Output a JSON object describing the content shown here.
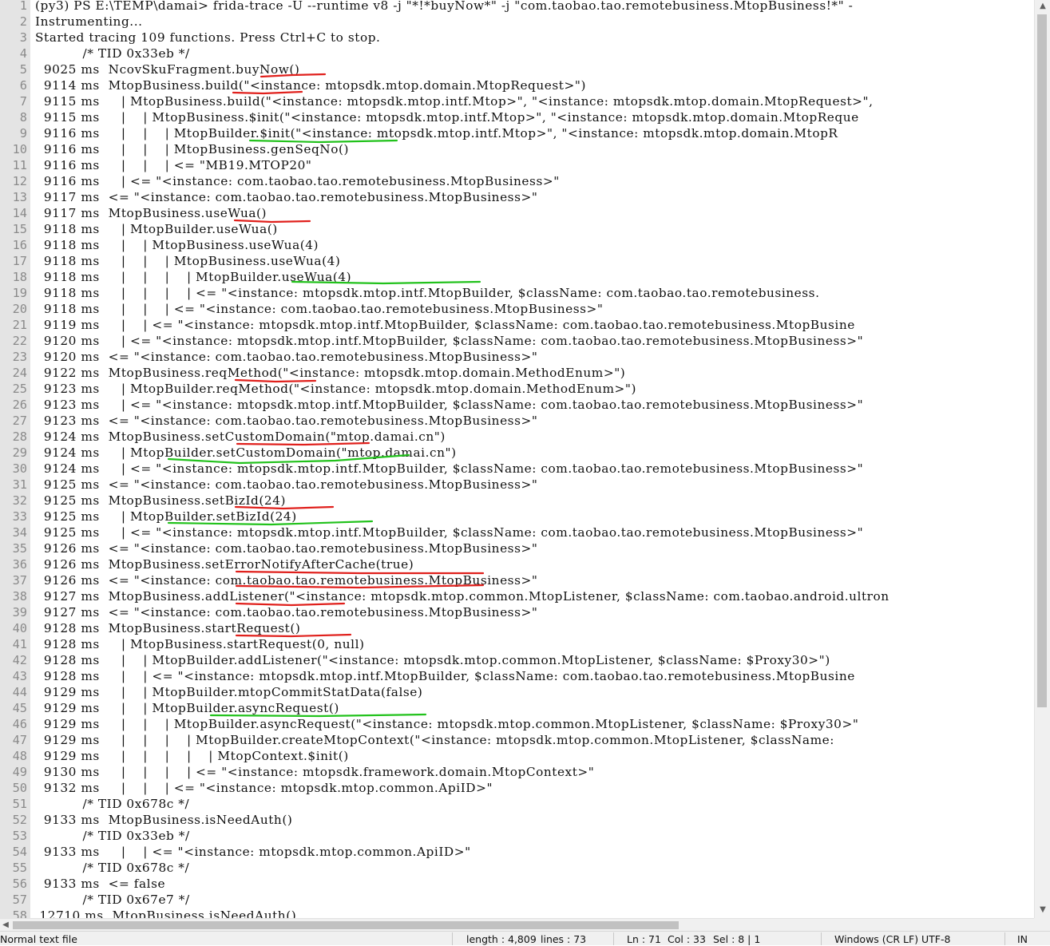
{
  "editor": {
    "lines": [
      {
        "n": "1",
        "t": "(py3) PS E:\\TEMP\\damai> frida-trace -U --runtime v8 -j \"*!*buyNow*\" -j \"com.taobao.tao.remotebusiness.MtopBusiness!*\" -"
      },
      {
        "n": "2",
        "t": "Instrumenting..."
      },
      {
        "n": "3",
        "t": "Started tracing 109 functions. Press Ctrl+C to stop."
      },
      {
        "n": "4",
        "t": "           /* TID 0x33eb */"
      },
      {
        "n": "5",
        "t": "  9025 ms  NcovSkuFragment.buyNow()"
      },
      {
        "n": "6",
        "t": "  9114 ms  MtopBusiness.build(\"<instance: mtopsdk.mtop.domain.MtopRequest>\")"
      },
      {
        "n": "7",
        "t": "  9115 ms     | MtopBusiness.build(\"<instance: mtopsdk.mtop.intf.Mtop>\", \"<instance: mtopsdk.mtop.domain.MtopRequest>\","
      },
      {
        "n": "8",
        "t": "  9115 ms     |    | MtopBusiness.$init(\"<instance: mtopsdk.mtop.intf.Mtop>\", \"<instance: mtopsdk.mtop.domain.MtopReque"
      },
      {
        "n": "9",
        "t": "  9116 ms     |    |    | MtopBuilder.$init(\"<instance: mtopsdk.mtop.intf.Mtop>\", \"<instance: mtopsdk.mtop.domain.MtopR"
      },
      {
        "n": "10",
        "t": "  9116 ms     |    |    | MtopBusiness.genSeqNo()"
      },
      {
        "n": "11",
        "t": "  9116 ms     |    |    | <= \"MB19.MTOP20\""
      },
      {
        "n": "12",
        "t": "  9116 ms     | <= \"<instance: com.taobao.tao.remotebusiness.MtopBusiness>\""
      },
      {
        "n": "13",
        "t": "  9117 ms  <= \"<instance: com.taobao.tao.remotebusiness.MtopBusiness>\""
      },
      {
        "n": "14",
        "t": "  9117 ms  MtopBusiness.useWua()"
      },
      {
        "n": "15",
        "t": "  9118 ms     | MtopBuilder.useWua()"
      },
      {
        "n": "16",
        "t": "  9118 ms     |    | MtopBusiness.useWua(4)"
      },
      {
        "n": "17",
        "t": "  9118 ms     |    |    | MtopBusiness.useWua(4)"
      },
      {
        "n": "18",
        "t": "  9118 ms     |    |    |    | MtopBuilder.useWua(4)"
      },
      {
        "n": "19",
        "t": "  9118 ms     |    |    |    | <= \"<instance: mtopsdk.mtop.intf.MtopBuilder, $className: com.taobao.tao.remotebusiness."
      },
      {
        "n": "20",
        "t": "  9118 ms     |    |    | <= \"<instance: com.taobao.tao.remotebusiness.MtopBusiness>\""
      },
      {
        "n": "21",
        "t": "  9119 ms     |    | <= \"<instance: mtopsdk.mtop.intf.MtopBuilder, $className: com.taobao.tao.remotebusiness.MtopBusine"
      },
      {
        "n": "22",
        "t": "  9120 ms     | <= \"<instance: mtopsdk.mtop.intf.MtopBuilder, $className: com.taobao.tao.remotebusiness.MtopBusiness>\""
      },
      {
        "n": "23",
        "t": "  9120 ms  <= \"<instance: com.taobao.tao.remotebusiness.MtopBusiness>\""
      },
      {
        "n": "24",
        "t": "  9122 ms  MtopBusiness.reqMethod(\"<instance: mtopsdk.mtop.domain.MethodEnum>\")"
      },
      {
        "n": "25",
        "t": "  9123 ms     | MtopBuilder.reqMethod(\"<instance: mtopsdk.mtop.domain.MethodEnum>\")"
      },
      {
        "n": "26",
        "t": "  9123 ms     | <= \"<instance: mtopsdk.mtop.intf.MtopBuilder, $className: com.taobao.tao.remotebusiness.MtopBusiness>\""
      },
      {
        "n": "27",
        "t": "  9123 ms  <= \"<instance: com.taobao.tao.remotebusiness.MtopBusiness>\""
      },
      {
        "n": "28",
        "t": "  9124 ms  MtopBusiness.setCustomDomain(\"mtop.damai.cn\")"
      },
      {
        "n": "29",
        "t": "  9124 ms     | MtopBuilder.setCustomDomain(\"mtop.damai.cn\")"
      },
      {
        "n": "30",
        "t": "  9124 ms     | <= \"<instance: mtopsdk.mtop.intf.MtopBuilder, $className: com.taobao.tao.remotebusiness.MtopBusiness>\""
      },
      {
        "n": "31",
        "t": "  9125 ms  <= \"<instance: com.taobao.tao.remotebusiness.MtopBusiness>\""
      },
      {
        "n": "32",
        "t": "  9125 ms  MtopBusiness.setBizId(24)"
      },
      {
        "n": "33",
        "t": "  9125 ms     | MtopBuilder.setBizId(24)"
      },
      {
        "n": "34",
        "t": "  9125 ms     | <= \"<instance: mtopsdk.mtop.intf.MtopBuilder, $className: com.taobao.tao.remotebusiness.MtopBusiness>\""
      },
      {
        "n": "35",
        "t": "  9126 ms  <= \"<instance: com.taobao.tao.remotebusiness.MtopBusiness>\""
      },
      {
        "n": "36",
        "t": "  9126 ms  MtopBusiness.setErrorNotifyAfterCache(true)"
      },
      {
        "n": "37",
        "t": "  9126 ms  <= \"<instance: com.taobao.tao.remotebusiness.MtopBusiness>\""
      },
      {
        "n": "38",
        "t": "  9127 ms  MtopBusiness.addListener(\"<instance: mtopsdk.mtop.common.MtopListener, $className: com.taobao.android.ultron"
      },
      {
        "n": "39",
        "t": "  9127 ms  <= \"<instance: com.taobao.tao.remotebusiness.MtopBusiness>\""
      },
      {
        "n": "40",
        "t": "  9128 ms  MtopBusiness.startRequest()"
      },
      {
        "n": "41",
        "t": "  9128 ms     | MtopBusiness.startRequest(0, null)"
      },
      {
        "n": "42",
        "t": "  9128 ms     |    | MtopBuilder.addListener(\"<instance: mtopsdk.mtop.common.MtopListener, $className: $Proxy30>\")"
      },
      {
        "n": "43",
        "t": "  9128 ms     |    | <= \"<instance: mtopsdk.mtop.intf.MtopBuilder, $className: com.taobao.tao.remotebusiness.MtopBusine"
      },
      {
        "n": "44",
        "t": "  9129 ms     |    | MtopBuilder.mtopCommitStatData(false)"
      },
      {
        "n": "45",
        "t": "  9129 ms     |    | MtopBuilder.asyncRequest()"
      },
      {
        "n": "46",
        "t": "  9129 ms     |    |    | MtopBuilder.asyncRequest(\"<instance: mtopsdk.mtop.common.MtopListener, $className: $Proxy30>\""
      },
      {
        "n": "47",
        "t": "  9129 ms     |    |    |    | MtopBuilder.createMtopContext(\"<instance: mtopsdk.mtop.common.MtopListener, $className:"
      },
      {
        "n": "48",
        "t": "  9129 ms     |    |    |    |    | MtopContext.$init()"
      },
      {
        "n": "49",
        "t": "  9130 ms     |    |    |    | <= \"<instance: mtopsdk.framework.domain.MtopContext>\""
      },
      {
        "n": "50",
        "t": "  9132 ms     |    |    | <= \"<instance: mtopsdk.mtop.common.ApiID>\""
      },
      {
        "n": "51",
        "t": "           /* TID 0x678c */"
      },
      {
        "n": "52",
        "t": "  9133 ms  MtopBusiness.isNeedAuth()"
      },
      {
        "n": "53",
        "t": "           /* TID 0x33eb */"
      },
      {
        "n": "54",
        "t": "  9133 ms     |    | <= \"<instance: mtopsdk.mtop.common.ApiID>\""
      },
      {
        "n": "55",
        "t": "           /* TID 0x678c */"
      },
      {
        "n": "56",
        "t": "  9133 ms  <= false"
      },
      {
        "n": "57",
        "t": "           /* TID 0x67e7 */"
      },
      {
        "n": "58",
        "t": " 12710 ms  MtopBusiness.isNeedAuth()"
      }
    ]
  },
  "annotations": {
    "colors": {
      "red": "#e0201c",
      "green": "#22c21c"
    }
  },
  "statusbar": {
    "file_type": "Normal text file",
    "length": "length : 4,809",
    "lines": "lines : 73",
    "ln": "Ln : 71",
    "col": "Col : 33",
    "sel": "Sel : 8 | 1",
    "eol": "Windows (CR LF)",
    "encoding": "UTF-8",
    "mode": "IN"
  },
  "icons": {
    "scroll_up": "scroll-up-arrow-icon",
    "scroll_down": "scroll-down-arrow-icon",
    "scroll_left": "scroll-left-arrow-icon"
  }
}
